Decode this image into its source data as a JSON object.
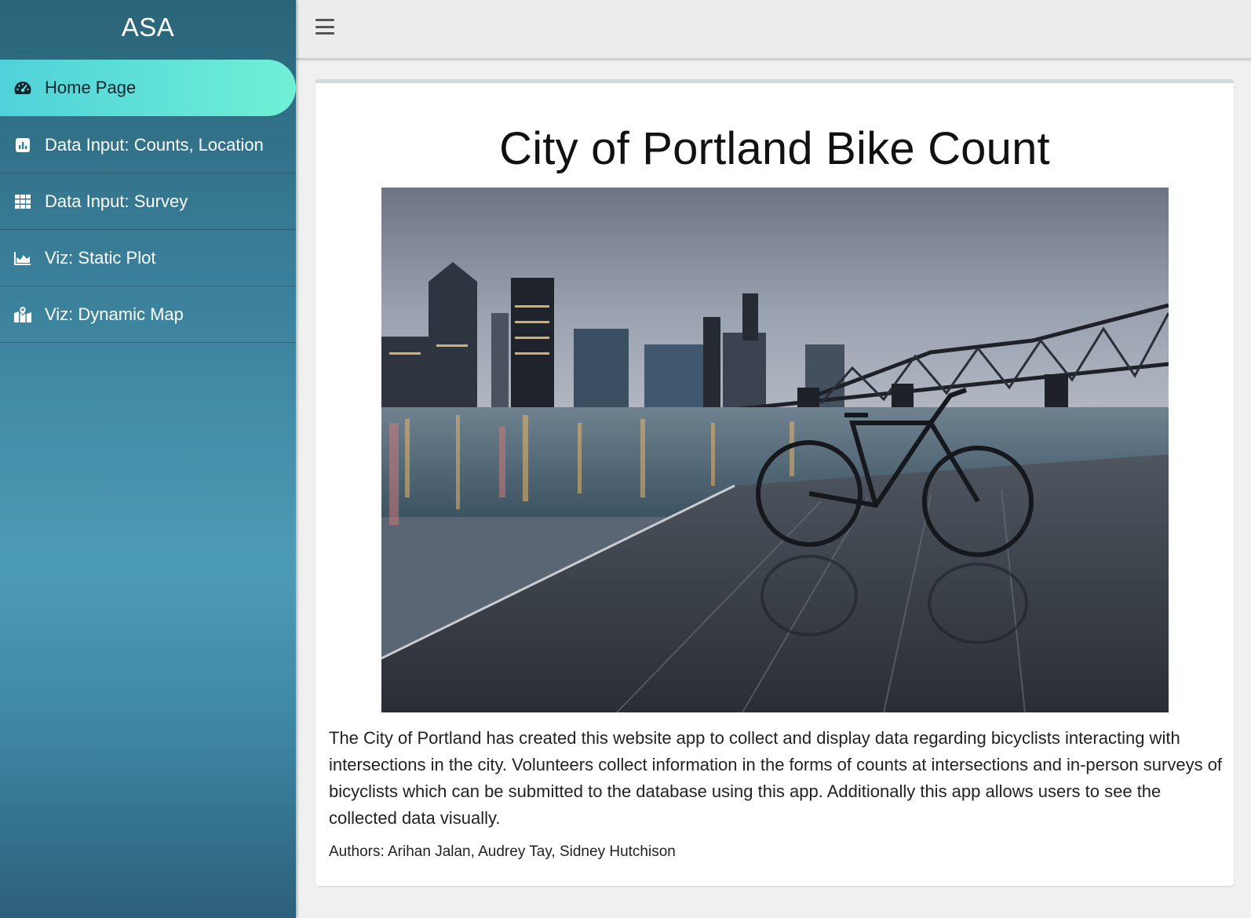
{
  "sidebar": {
    "brand": "ASA",
    "items": [
      {
        "label": "Home Page",
        "icon": "dashboard-gauge-icon",
        "active": true
      },
      {
        "label": "Data Input: Counts, Location",
        "icon": "bar-chart-square-icon",
        "active": false
      },
      {
        "label": "Data Input: Survey",
        "icon": "grid-table-icon",
        "active": false
      },
      {
        "label": "Viz: Static Plot",
        "icon": "area-chart-icon",
        "active": false
      },
      {
        "label": "Viz: Dynamic Map",
        "icon": "map-marked-icon",
        "active": false
      }
    ]
  },
  "topbar": {
    "toggle_icon": "hamburger-menu-icon"
  },
  "main": {
    "title": "City of Portland Bike Count",
    "image_alt": "Bicycle on a wet dock with Portland skyline and a steel truss bridge at dusk",
    "description": "The City of Portland has created this website app to collect and display data regarding bicyclists interacting with intersections in the city. Volunteers collect information in the forms of counts at intersections and in-person surveys of bicyclists which can be submitted to the database using this app. Additionally this app allows users to see the collected data visually.",
    "authors": "Authors: Arihan Jalan, Audrey Tay, Sidney Hutchison"
  },
  "colors": {
    "sidebar_top": "#2a6478",
    "sidebar_mid": "#4d9cb5",
    "active_start": "#4fd1d9",
    "active_end": "#6ff0d6",
    "topbar_bg": "#ececec",
    "content_bg": "#ffffff"
  }
}
